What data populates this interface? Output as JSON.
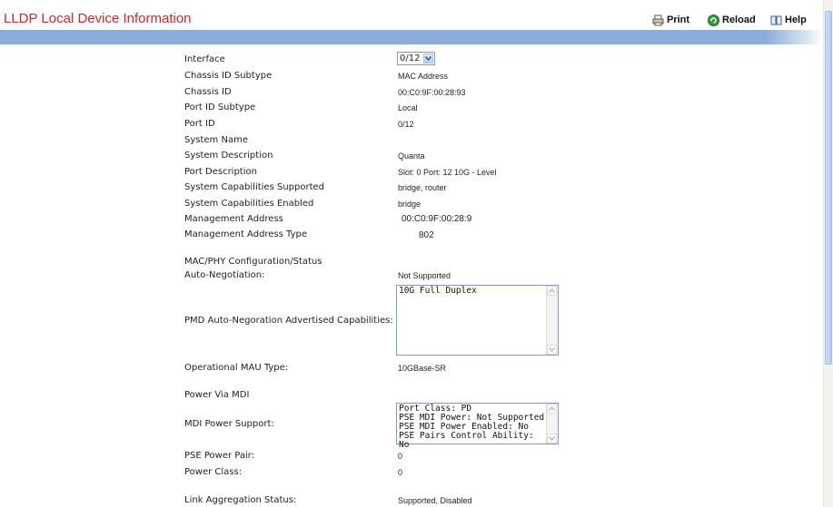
{
  "header": {
    "title": "LLDP Local Device Information",
    "print_label": "Print",
    "reload_label": "Reload",
    "help_label": "Help"
  },
  "colors": {
    "title": "#cc2a2a",
    "band": "#8aaed7"
  },
  "interface": {
    "label": "Interface",
    "selected": "0/12"
  },
  "fields": [
    {
      "label": "Chassis ID Subtype",
      "value": "MAC Address"
    },
    {
      "label": "Chassis ID",
      "value": "00:C0:9F:00:28:93"
    },
    {
      "label": "Port ID Subtype",
      "value": "Local"
    },
    {
      "label": "Port ID",
      "value": "0/12"
    },
    {
      "label": "System Name",
      "value": ""
    },
    {
      "label": "System Description",
      "value": "Quanta"
    },
    {
      "label": "Port Description",
      "value": "Slot: 0 Port: 12 10G - Level"
    },
    {
      "label": "System Capabilities Supported",
      "value": "bridge, router"
    },
    {
      "label": "System Capabilities Enabled",
      "value": "bridge"
    },
    {
      "label": "Management Address",
      "value": "00:C0:9F:00:28:9"
    },
    {
      "label": "Management Address Type",
      "value": "802"
    }
  ],
  "macphy": {
    "section_label": "MAC/PHY Configuration/Status",
    "autoneg_label": "Auto-Negotiation:",
    "autoneg_value": "Not Supported",
    "pmd_label": "PMD Auto-Negoration Advertised Capabilities:",
    "pmd_items": [
      "10G Full Duplex"
    ],
    "mau_label": "Operational MAU Type:",
    "mau_value": "10GBase-SR"
  },
  "power": {
    "section_label": "Power Via MDI",
    "mdi_label": "MDI Power Support:",
    "mdi_items": [
      "Port Class: PD",
      "PSE MDI Power: Not Supported",
      "PSE MDI Power Enabled: No",
      "PSE Pairs Control Ability: No"
    ],
    "pair_label": "PSE Power Pair:",
    "pair_value": "0",
    "class_label": "Power Class:",
    "class_value": "0"
  },
  "link_agg": {
    "label": "Link Aggregation Status:",
    "value": "Supported, Disabled"
  }
}
